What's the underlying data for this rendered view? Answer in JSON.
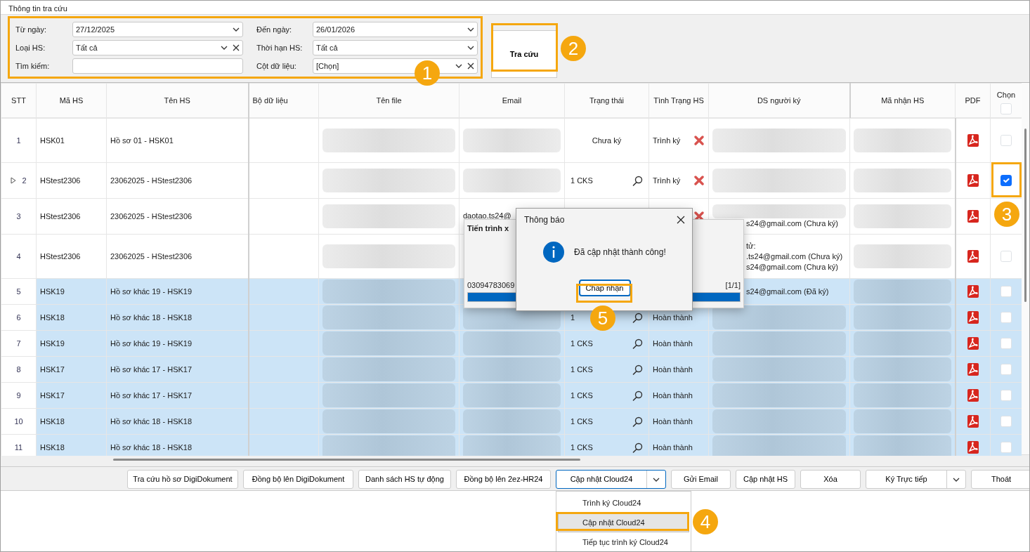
{
  "window": {
    "title": "Thông tin tra cứu"
  },
  "filters": [
    {
      "label": "Từ ngày:",
      "kind": "dropdown",
      "value": "27/12/2025",
      "clearable": false
    },
    {
      "label": "Đến ngày:",
      "kind": "dropdown",
      "value": "26/01/2026",
      "clearable": false
    },
    {
      "label": "Loại HS:",
      "kind": "dropdown",
      "value": "Tất cả",
      "clearable": true
    },
    {
      "label": "Thời hạn HS:",
      "kind": "dropdown",
      "value": "Tất cả",
      "clearable": false
    },
    {
      "label": "Tìm kiếm:",
      "kind": "text"
    },
    {
      "label": "Cột dữ liệu:",
      "kind": "dropdown",
      "value": "[Chọn]",
      "clearable": true
    }
  ],
  "search_button": {
    "label": "Tra cứu"
  },
  "table": {
    "columns": [
      "STT",
      "Mã HS",
      "Tên HS",
      "Bộ dữ liệu",
      "Tên file",
      "Email",
      "Trạng thái",
      "Tình Trạng HS",
      "DS người ký",
      "Mã nhận HS",
      "PDF",
      "Chọn"
    ],
    "select_all_checked": false,
    "rows": [
      {
        "stt": "1",
        "code": "HSK01",
        "name": "Hồ sơ 01 - HSK01",
        "signature": "Chưa ký",
        "lookup": false,
        "record_status": "Trình ký",
        "rejected": true,
        "current": false,
        "selected": false,
        "checked": false,
        "file_blurred": true,
        "email_blurred": true,
        "signers_blurred": true,
        "receipt_blurred": true
      },
      {
        "stt": "2",
        "code": "HStest2306",
        "name": "23062025 - HStest2306",
        "signature": "1 CKS",
        "lookup": true,
        "record_status": "Trình ký",
        "rejected": true,
        "current": true,
        "selected": false,
        "checked": true,
        "file_blurred": true,
        "email_blurred": true,
        "signers_blurred": true,
        "receipt_blurred": true
      },
      {
        "stt": "3",
        "code": "HStest2306",
        "name": "23062025 - HStest2306",
        "email": "daotao.ts24@",
        "rejected": true,
        "current": false,
        "selected": false,
        "signers": [
          "s24@gmail.com (Chưa ký)"
        ],
        "file_blurred": true,
        "email_blurred": false,
        "signers_blurred": true,
        "receipt_blurred": true
      },
      {
        "stt": "4",
        "code": "HStest2306",
        "name": "23062025 - HStest2306",
        "current": false,
        "selected": false,
        "checked": false,
        "signers": [
          "tử:",
          ".ts24@gmail.com (Chưa ký)",
          "s24@gmail.com (Chưa ký)"
        ],
        "file_blurred": true,
        "signers_blurred": false,
        "receipt_blurred": true
      },
      {
        "stt": "5",
        "code": "HSK19",
        "name": "Hồ sơ khác 19 - HSK19",
        "current": false,
        "selected": true,
        "checked": false,
        "signers": [
          "s24@gmail.com (Đã ký)"
        ],
        "file_blurred": true,
        "signers_blurred": false,
        "receipt_blurred": true
      },
      {
        "stt": "6",
        "code": "HSK18",
        "name": "Hồ sơ khác 18 - HSK18",
        "signature": "1",
        "lookup": true,
        "record_status": "Hoàn thành",
        "rejected": false,
        "current": false,
        "selected": true,
        "checked": false,
        "file_blurred": true,
        "email_blurred": true,
        "signers_blurred": true,
        "receipt_blurred": true
      },
      {
        "stt": "7",
        "code": "HSK19",
        "name": "Hồ sơ khác 19 - HSK19",
        "signature": "1 CKS",
        "lookup": true,
        "record_status": "Hoàn thành",
        "rejected": false,
        "current": false,
        "selected": true,
        "checked": false,
        "file_blurred": true,
        "email_blurred": true,
        "signers_blurred": true,
        "receipt_blurred": true
      },
      {
        "stt": "8",
        "code": "HSK17",
        "name": "Hồ sơ khác 17 - HSK17",
        "signature": "1 CKS",
        "lookup": true,
        "record_status": "Hoàn thành",
        "rejected": false,
        "current": false,
        "selected": true,
        "checked": false,
        "file_blurred": true,
        "email_blurred": true,
        "signers_blurred": true,
        "receipt_blurred": true
      },
      {
        "stt": "9",
        "code": "HSK17",
        "name": "Hồ sơ khác 17 - HSK17",
        "signature": "1 CKS",
        "lookup": true,
        "record_status": "Hoàn thành",
        "rejected": false,
        "current": false,
        "selected": true,
        "checked": false,
        "file_blurred": true,
        "email_blurred": true,
        "signers_blurred": true,
        "receipt_blurred": true
      },
      {
        "stt": "10",
        "code": "HSK18",
        "name": "Hồ sơ khác 18 - HSK18",
        "signature": "1 CKS",
        "lookup": true,
        "record_status": "Hoàn thành",
        "rejected": false,
        "current": false,
        "selected": true,
        "checked": false,
        "file_blurred": true,
        "email_blurred": true,
        "signers_blurred": true,
        "receipt_blurred": true
      },
      {
        "stt": "11",
        "code": "HSK18",
        "name": "Hồ sơ khác 18 - HSK18",
        "signature": "1 CKS",
        "lookup": true,
        "record_status": "Hoàn thành",
        "rejected": false,
        "current": false,
        "selected": true,
        "checked": false,
        "file_blurred": true,
        "email_blurred": true,
        "signers_blurred": true,
        "receipt_blurred": true
      }
    ]
  },
  "toolbar": [
    {
      "label": "Tra cứu hồ sơ DigiDokument",
      "kind": "button",
      "focused": false
    },
    {
      "label": "Đồng bộ lên DigiDokument",
      "kind": "button",
      "focused": false
    },
    {
      "label": "Danh sách HS tự động",
      "kind": "button",
      "focused": false
    },
    {
      "label": "Đồng bộ lên 2ez-HR24",
      "kind": "button",
      "focused": false
    },
    {
      "label": "Cập nhật Cloud24",
      "kind": "split",
      "focused": true
    },
    {
      "label": "Gửi Email",
      "kind": "button",
      "focused": false
    },
    {
      "label": "Cập nhật HS",
      "kind": "button",
      "focused": false
    },
    {
      "label": "Xóa",
      "kind": "button",
      "focused": false
    },
    {
      "label": "Ký Trực tiếp",
      "kind": "split",
      "focused": false
    },
    {
      "label": "Thoát",
      "kind": "button",
      "focused": false
    }
  ],
  "dropdown_menu": [
    {
      "label": "Trình ký Cloud24",
      "selected": false
    },
    {
      "label": "Cập nhật Cloud24",
      "selected": true
    },
    {
      "label": "Tiếp tục trình ký Cloud24",
      "selected": false
    }
  ],
  "progress_window": {
    "title": "Tiến trình x",
    "code": "03094783069",
    "count": "[1/1]",
    "level": 1
  },
  "message_dialog": {
    "title": "Thông báo",
    "message": "Đã cập nhật thành công!",
    "button": "Chấp nhận"
  },
  "annotations": [
    {
      "number": "1"
    },
    {
      "number": "2"
    },
    {
      "number": "3"
    },
    {
      "number": "4"
    },
    {
      "number": "5"
    }
  ]
}
